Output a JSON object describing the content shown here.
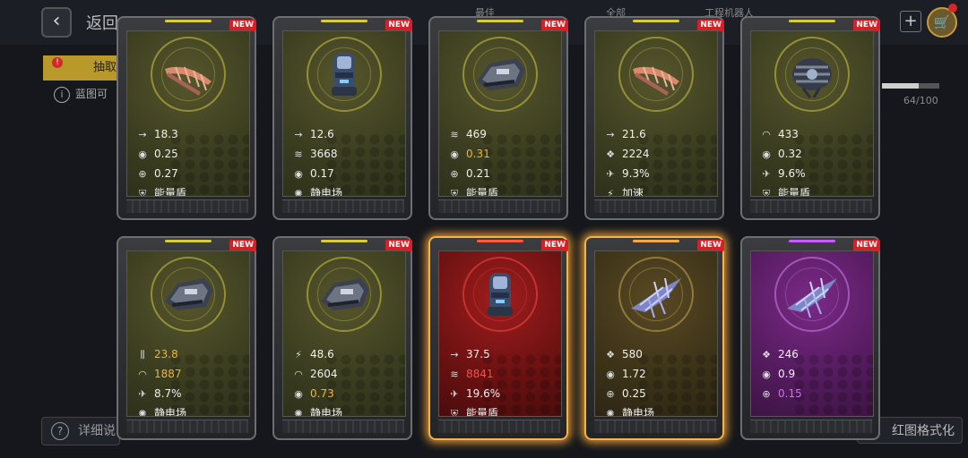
{
  "header": {
    "back_label": "返回",
    "tabs": [
      "最佳",
      "全部",
      "工程机器人"
    ],
    "plus": "+"
  },
  "sidebar": {
    "tab_label": "抽取",
    "info_text": "蓝图可",
    "warn": "!"
  },
  "progress": {
    "text": "64/100",
    "fraction": 0.64
  },
  "footer": {
    "left_label": "详细说明",
    "right_label": "红图格式化"
  },
  "icons": {
    "arrow": "→",
    "fire": "◉",
    "crosshair": "⊕",
    "shield": "⛨",
    "static": "✺",
    "capacity": "≋",
    "cluster": "❖",
    "rocket": "✈",
    "dome": "◠",
    "ammo": "⫼",
    "dodge": "⚡"
  },
  "colors": {
    "yellow": "#d8cc3a",
    "red": "#ff5a3c",
    "orange": "#f2a84a",
    "purple": "#c85cff",
    "stat_gold": "#f2b232",
    "stat_red": "#ff4b4b",
    "stat_purple": "#d36bff"
  },
  "cards": [
    {
      "badge": "NEW",
      "rarity": "yellow",
      "bg": "y",
      "item": "claw",
      "glow": false,
      "stats": [
        {
          "icon": "arrow",
          "value": "18.3",
          "tone": ""
        },
        {
          "icon": "fire",
          "value": "0.25",
          "tone": ""
        },
        {
          "icon": "crosshair",
          "value": "0.27",
          "tone": ""
        },
        {
          "icon": "shield",
          "value": "能量盾",
          "tone": ""
        }
      ]
    },
    {
      "badge": "NEW",
      "rarity": "yellow",
      "bg": "y",
      "item": "cannon",
      "glow": false,
      "stats": [
        {
          "icon": "arrow",
          "value": "12.6",
          "tone": ""
        },
        {
          "icon": "capacity",
          "value": "3668",
          "tone": ""
        },
        {
          "icon": "fire",
          "value": "0.17",
          "tone": ""
        },
        {
          "icon": "static",
          "value": "静电场",
          "tone": ""
        }
      ]
    },
    {
      "badge": "NEW",
      "rarity": "yellow",
      "bg": "y",
      "item": "tank",
      "glow": false,
      "stats": [
        {
          "icon": "capacity",
          "value": "469",
          "tone": ""
        },
        {
          "icon": "fire",
          "value": "0.31",
          "tone": "gold"
        },
        {
          "icon": "crosshair",
          "value": "0.21",
          "tone": ""
        },
        {
          "icon": "shield",
          "value": "能量盾",
          "tone": ""
        }
      ]
    },
    {
      "badge": "NEW",
      "rarity": "yellow",
      "bg": "y",
      "item": "claw",
      "glow": false,
      "stats": [
        {
          "icon": "arrow",
          "value": "21.6",
          "tone": ""
        },
        {
          "icon": "cluster",
          "value": "2224",
          "tone": ""
        },
        {
          "icon": "rocket",
          "value": "9.3%",
          "tone": ""
        },
        {
          "icon": "dodge",
          "value": "加速",
          "tone": ""
        }
      ]
    },
    {
      "badge": "NEW",
      "rarity": "yellow",
      "bg": "y",
      "item": "pod",
      "glow": false,
      "stats": [
        {
          "icon": "dome",
          "value": "433",
          "tone": ""
        },
        {
          "icon": "fire",
          "value": "0.32",
          "tone": ""
        },
        {
          "icon": "rocket",
          "value": "9.6%",
          "tone": ""
        },
        {
          "icon": "shield",
          "value": "能量盾",
          "tone": ""
        }
      ]
    },
    {
      "badge": "NEW",
      "rarity": "yellow",
      "bg": "y",
      "item": "tank",
      "glow": false,
      "stats": [
        {
          "icon": "ammo",
          "value": "23.8",
          "tone": "gold"
        },
        {
          "icon": "dome",
          "value": "1887",
          "tone": "gold"
        },
        {
          "icon": "rocket",
          "value": "8.7%",
          "tone": ""
        },
        {
          "icon": "static",
          "value": "静电场",
          "tone": ""
        }
      ]
    },
    {
      "badge": "NEW",
      "rarity": "yellow",
      "bg": "y",
      "item": "tank",
      "glow": false,
      "stats": [
        {
          "icon": "dodge",
          "value": "48.6",
          "tone": ""
        },
        {
          "icon": "dome",
          "value": "2604",
          "tone": ""
        },
        {
          "icon": "fire",
          "value": "0.73",
          "tone": "gold"
        },
        {
          "icon": "static",
          "value": "静电场",
          "tone": ""
        }
      ]
    },
    {
      "badge": "NEW",
      "rarity": "red",
      "bg": "r",
      "item": "cannon",
      "glow": true,
      "stats": [
        {
          "icon": "arrow",
          "value": "37.5",
          "tone": ""
        },
        {
          "icon": "capacity",
          "value": "8841",
          "tone": "red"
        },
        {
          "icon": "rocket",
          "value": "19.6%",
          "tone": ""
        },
        {
          "icon": "shield",
          "value": "能量盾",
          "tone": ""
        }
      ]
    },
    {
      "badge": "NEW",
      "rarity": "orange",
      "bg": "o",
      "item": "jet",
      "glow": true,
      "stats": [
        {
          "icon": "cluster",
          "value": "580",
          "tone": ""
        },
        {
          "icon": "fire",
          "value": "1.72",
          "tone": ""
        },
        {
          "icon": "crosshair",
          "value": "0.25",
          "tone": ""
        },
        {
          "icon": "static",
          "value": "静电场",
          "tone": ""
        }
      ]
    },
    {
      "badge": "NEW",
      "rarity": "purple",
      "bg": "p",
      "item": "jet",
      "glow": false,
      "stats": [
        {
          "icon": "cluster",
          "value": "246",
          "tone": ""
        },
        {
          "icon": "fire",
          "value": "0.9",
          "tone": ""
        },
        {
          "icon": "crosshair",
          "value": "0.15",
          "tone": "purple"
        }
      ]
    }
  ]
}
